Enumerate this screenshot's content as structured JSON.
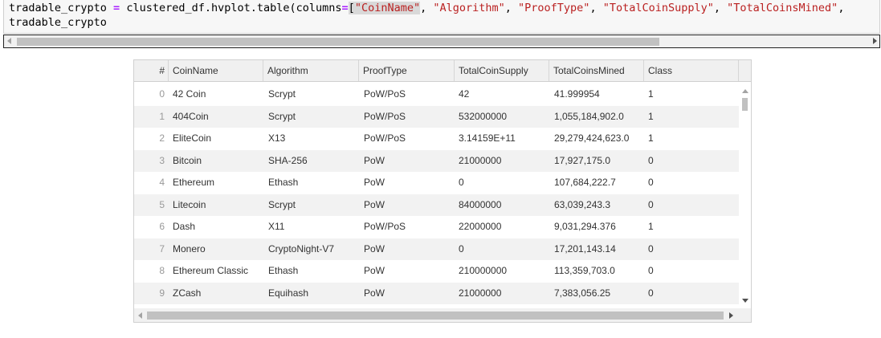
{
  "code": {
    "line1_var": "tradable_crypto",
    "line1_eq": " = ",
    "line1_call": "clustered_df.hvplot.table(columns",
    "line1_kwarg_eq": "=",
    "line1_bracket": "[",
    "line1_strings": [
      "\"CoinName\"",
      "\"Algorithm\"",
      "\"ProofType\"",
      "\"TotalCoinSupply\"",
      "\"TotalCoinsMined\""
    ],
    "line1_sep": ", ",
    "line2": "tradable_crypto"
  },
  "table": {
    "columns": [
      "#",
      "CoinName",
      "Algorithm",
      "ProofType",
      "TotalCoinSupply",
      "TotalCoinsMined",
      "Class"
    ],
    "rows": [
      [
        "0",
        "42 Coin",
        "Scrypt",
        "PoW/PoS",
        "42",
        "41.999954",
        "1"
      ],
      [
        "1",
        "404Coin",
        "Scrypt",
        "PoW/PoS",
        "532000000",
        "1,055,184,902.0",
        "1"
      ],
      [
        "2",
        "EliteCoin",
        "X13",
        "PoW/PoS",
        "3.14159E+11",
        "29,279,424,623.0",
        "1"
      ],
      [
        "3",
        "Bitcoin",
        "SHA-256",
        "PoW",
        "21000000",
        "17,927,175.0",
        "0"
      ],
      [
        "4",
        "Ethereum",
        "Ethash",
        "PoW",
        "0",
        "107,684,222.7",
        "0"
      ],
      [
        "5",
        "Litecoin",
        "Scrypt",
        "PoW",
        "84000000",
        "63,039,243.3",
        "0"
      ],
      [
        "6",
        "Dash",
        "X11",
        "PoW/PoS",
        "22000000",
        "9,031,294.376",
        "1"
      ],
      [
        "7",
        "Monero",
        "CryptoNight-V7",
        "PoW",
        "0",
        "17,201,143.14",
        "0"
      ],
      [
        "8",
        "Ethereum Classic",
        "Ethash",
        "PoW",
        "210000000",
        "113,359,703.0",
        "0"
      ],
      [
        "9",
        "ZCash",
        "Equihash",
        "PoW",
        "21000000",
        "7,383,056.25",
        "0"
      ]
    ]
  }
}
